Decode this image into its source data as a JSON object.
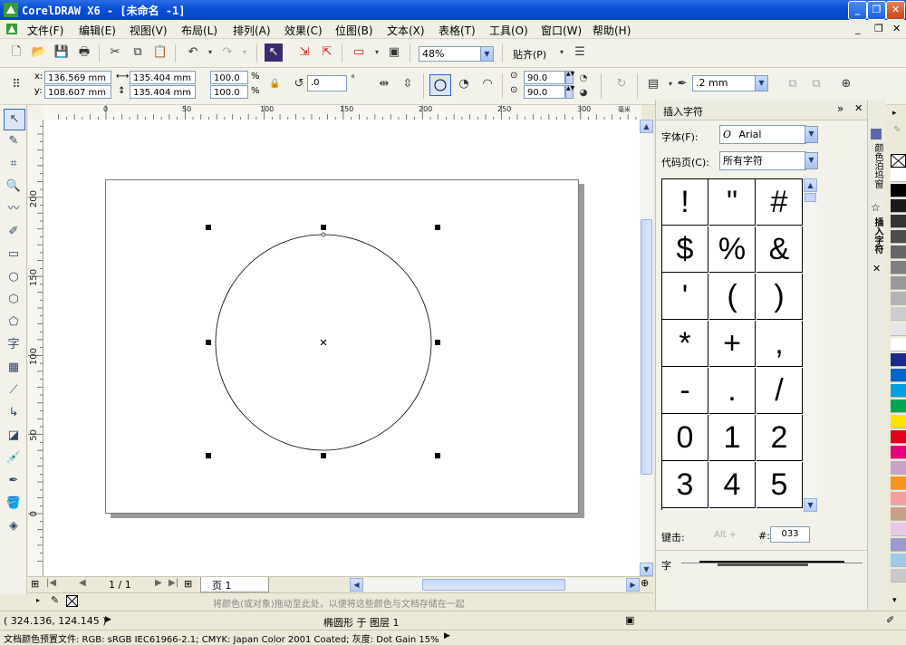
{
  "window": {
    "title": "CorelDRAW X6 - [未命名 -1]",
    "minimize": "_",
    "restore": "❐",
    "close": "✕",
    "doc_min": "_",
    "doc_restore": "❐",
    "doc_close": "✕"
  },
  "menu": [
    "文件(F)",
    "编辑(E)",
    "视图(V)",
    "布局(L)",
    "排列(A)",
    "效果(C)",
    "位图(B)",
    "文本(X)",
    "表格(T)",
    "工具(O)",
    "窗口(W)",
    "帮助(H)"
  ],
  "standard_toolbar": {
    "zoom_level": "48%",
    "snap_label": "贴齐(P)"
  },
  "property_bar": {
    "x_label": "x:",
    "y_label": "y:",
    "x_value": "136.569 mm",
    "y_value": "108.607 mm",
    "width_value": "135.404 mm",
    "height_value": "135.404 mm",
    "scale_x": "100.0",
    "scale_y": "100.0",
    "percent": "%",
    "rotation": ".0",
    "degree": "°",
    "start_angle": "90.0",
    "end_angle": "90.0",
    "outline_width": ".2 mm"
  },
  "rulers": {
    "horizontal_ticks": [
      "0",
      "50",
      "100",
      "150",
      "200",
      "250",
      "300"
    ],
    "vertical_ticks": [
      "200",
      "150",
      "100",
      "50",
      "0"
    ],
    "unit": "毫米"
  },
  "page_nav": {
    "page_counter": "1 / 1",
    "page_tab": "页 1"
  },
  "color_bar_hint": "将颜色(或对象)拖动至此处，以便将这些颜色与文档存储在一起",
  "status": {
    "coordinates": "( 324.136, 124.145 )",
    "object_info": "椭圆形 于 图层 1",
    "color_profile": "文档颜色预置文件: RGB: sRGB IEC61966-2.1; CMYK: Japan Color 2001 Coated; 灰度: Dot Gain 15%"
  },
  "docker": {
    "title": "插入字符",
    "font_label": "字体(F):",
    "font_value": "Arial",
    "code_page_label": "代码页(C):",
    "code_page_value": "所有字符",
    "characters": [
      "!",
      "\"",
      "#",
      "$",
      "%",
      "&",
      "'",
      "(",
      ")",
      "*",
      "+",
      ",",
      "-",
      ".",
      "/",
      "0",
      "1",
      "2",
      "3",
      "4",
      "5"
    ],
    "keystroke_label": "键击:",
    "alt_hint": "Alt +",
    "hash_label": "#:",
    "char_code": "033",
    "char_label": "字"
  },
  "docker_tabs": {
    "tab1": "颜色泊坞窗",
    "tab2": "插入字符"
  },
  "palette_colors": [
    "#ffffff",
    "#000000",
    "#1a1a1a",
    "#333333",
    "#4d4d4d",
    "#666666",
    "#808080",
    "#999999",
    "#b3b3b3",
    "#cccccc",
    "#e6e6e6",
    "#ffffff",
    "#1a2a8c",
    "#0066cc",
    "#00a0e0",
    "#00a651",
    "#ffe100",
    "#e2001a",
    "#e4007f",
    "#c8a0c8",
    "#f7941d",
    "#f5a0a0",
    "#c8a088",
    "#e8c8e8",
    "#9b9bd0",
    "#a0c8e8",
    "#c8c8c8"
  ]
}
